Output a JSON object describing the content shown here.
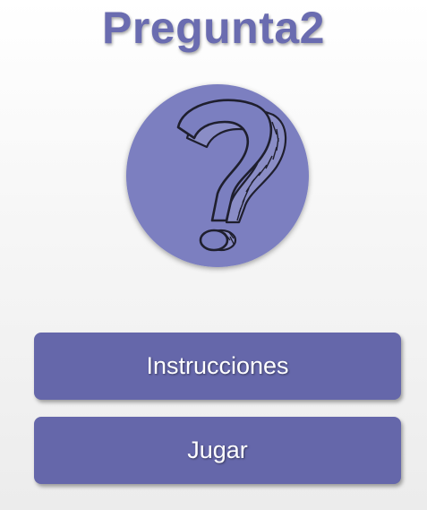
{
  "app": {
    "title": "Pregunta2"
  },
  "logo": {
    "icon": "question-mark-icon",
    "circle_color": "#7b7fc0"
  },
  "menu": {
    "instrucciones_label": "Instrucciones",
    "jugar_label": "Jugar"
  },
  "colors": {
    "title": "#6a6cb0",
    "button": "#6567aa",
    "button_text": "#ffffff"
  }
}
